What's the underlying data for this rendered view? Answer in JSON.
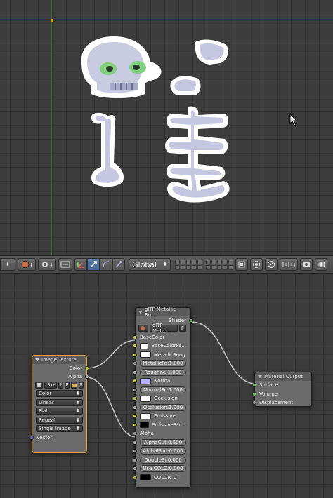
{
  "viewport": {
    "sprites": [
      "skull-sprite",
      "hand-sprite",
      "bone-sprite",
      "ribcage-sprite"
    ]
  },
  "header": {
    "orientation": "Global",
    "buttons": [
      "mode-icon",
      "shading-icon",
      "pivot-icon",
      "manipulator-icon",
      "translate-icon",
      "rotate-icon",
      "scale-icon"
    ]
  },
  "nodes": {
    "image_texture": {
      "title": "Image Texture",
      "out_color": "Color",
      "out_alpha": "Alpha",
      "image_name": "Ske",
      "users": "2",
      "fake": "F",
      "color_space": "Color",
      "interpolation": "Linear",
      "projection": "Flat",
      "extension": "Repeat",
      "source": "Single Image",
      "in_vector": "Vector"
    },
    "gltf": {
      "title": "glTF Metallic Ro...",
      "out_shader": "Shader",
      "group_name": "glTF Meta...",
      "fake": "F",
      "base_color": "BaseColor",
      "base_color_factor": "BaseColorFa...",
      "metallic_rough": "MetallicRoug",
      "metallic_factor": "MetallicFa:1.000",
      "roughness_factor": "Roughne:1.000",
      "normal": "Normal",
      "normal_scale": "NormalSc:1.000",
      "occlusion": "Occlusion",
      "occlusion_factor": "Occlusion:1.000",
      "emissive": "Emissive",
      "emissive_factor": "EmissiveFac...",
      "alpha": "Alpha",
      "alpha_cutoff": "AlphaCut:0.500",
      "alpha_mode": "AlphaMod:0.000",
      "double_sided": "DoubleSi:0.000",
      "use_color0": "Use COLO:0.000",
      "color0": "COLOR_0"
    },
    "material_output": {
      "title": "Material Output",
      "surface": "Surface",
      "volume": "Volume",
      "displacement": "Displacement"
    }
  },
  "colors": {
    "socket_color": "#c7c729",
    "socket_float": "#a1a1a1",
    "socket_shader": "#63c763",
    "socket_vector": "#6363c7",
    "selected_outline": "#f0a030",
    "normal_swatch": "#b3b3ff"
  }
}
